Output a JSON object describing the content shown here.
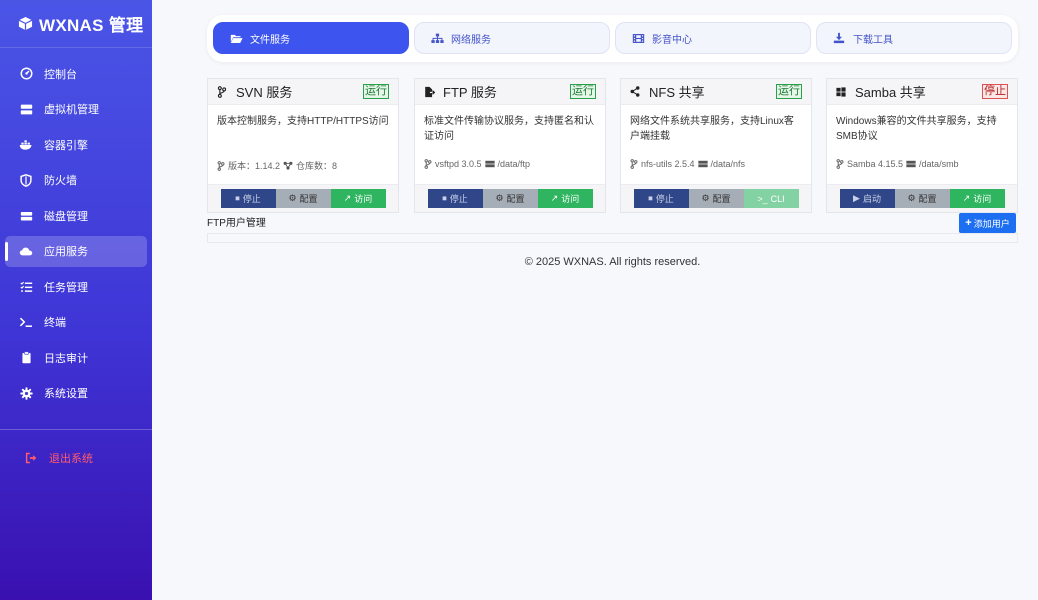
{
  "brand": {
    "title": "WXNAS 管理"
  },
  "sidebar": {
    "items": [
      {
        "label": "控制台",
        "icon": "dashboard-icon"
      },
      {
        "label": "虚拟机管理",
        "icon": "server-icon"
      },
      {
        "label": "容器引擎",
        "icon": "docker-icon"
      },
      {
        "label": "防火墙",
        "icon": "shield-icon"
      },
      {
        "label": "磁盘管理",
        "icon": "hdd-icon"
      },
      {
        "label": "应用服务",
        "icon": "cloud-icon"
      },
      {
        "label": "任务管理",
        "icon": "tasks-icon"
      },
      {
        "label": "终端",
        "icon": "terminal-icon"
      },
      {
        "label": "日志审计",
        "icon": "clipboard-icon"
      },
      {
        "label": "系统设置",
        "icon": "gear-icon"
      }
    ],
    "logout": "退出系统"
  },
  "tabs": [
    {
      "label": "文件服务",
      "icon": "folder-open-icon"
    },
    {
      "label": "网络服务",
      "icon": "network-icon"
    },
    {
      "label": "影音中心",
      "icon": "film-icon"
    },
    {
      "label": "下载工具",
      "icon": "download-icon"
    }
  ],
  "cards": [
    {
      "title": "SVN 服务",
      "status": "运行",
      "desc": "版本控制服务，支持HTTP/HTTPS访问",
      "meta1": "版本：1.14.2",
      "meta2": "仓库数：8",
      "btn1": "停止",
      "btn2": "配置",
      "btn3": "访问"
    },
    {
      "title": "FTP 服务",
      "status": "运行",
      "desc": "标准文件传输协议服务，支持匿名和认证访问",
      "meta1": "vsftpd 3.0.5",
      "meta2": "/data/ftp",
      "btn1": "停止",
      "btn2": "配置",
      "btn3": "访问"
    },
    {
      "title": "NFS 共享",
      "status": "运行",
      "desc": "网络文件系统共享服务，支持Linux客户端挂载",
      "meta1": "nfs-utils 2.5.4",
      "meta2": "/data/nfs",
      "btn1": "停止",
      "btn2": "配置",
      "btn3": "CLI"
    },
    {
      "title": "Samba 共享",
      "status": "停止",
      "desc": "Windows兼容的文件共享服务，支持SMB协议",
      "meta1": "Samba 4.15.5",
      "meta2": "/data/smb",
      "btn1": "启动",
      "btn2": "配置",
      "btn3": "访问"
    }
  ],
  "ftp_users": {
    "label": "FTP用户管理",
    "add_button": "添加用户"
  },
  "footer": "© 2025 WXNAS. All rights reserved.",
  "colors": {
    "accent": "#3d54ee",
    "running": "#27a24a",
    "stopped": "#e05252",
    "add": "#1d6ff2"
  }
}
